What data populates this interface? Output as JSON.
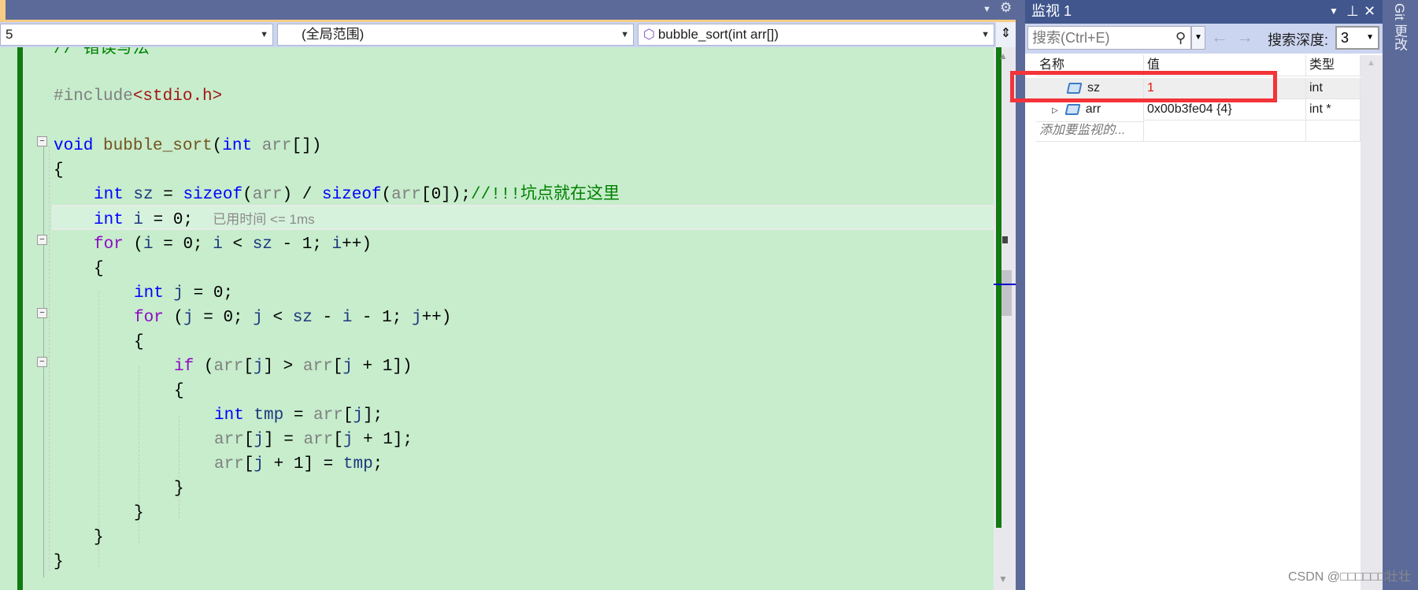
{
  "toolbar": {
    "gear_icon": "gear",
    "dropdown_icon": "triangle-down"
  },
  "nav": {
    "project": "5",
    "scope": "(全局范围)",
    "function": "bubble_sort(int arr[])"
  },
  "editor": {
    "comment": "// 错误写法",
    "include_directive": "#include",
    "include_file": "<stdio.h>",
    "code_lines": [
      "void bubble_sort(int arr[])",
      "{",
      "int sz = sizeof(arr) / sizeof(arr[0]);",
      "//!!!坑点就在这里",
      "int i = 0;",
      "for (i = 0; i < sz - 1; i++)",
      "{",
      "int j = 0;",
      "for (j = 0; j < sz - i - 1; j++)",
      "{",
      "if (arr[j] > arr[j + 1])",
      "{",
      "int tmp = arr[j];",
      "arr[j] = arr[j + 1];",
      "arr[j + 1] = tmp;",
      "}",
      "}",
      "}",
      "}"
    ],
    "perf_tip": "已用时间 <= 1ms"
  },
  "watch": {
    "title": "监视 1",
    "search_placeholder": "搜索(Ctrl+E)",
    "depth_label": "搜索深度:",
    "depth_value": "3",
    "columns": [
      "名称",
      "值",
      "类型"
    ],
    "rows": [
      {
        "name": "sz",
        "value": "1",
        "type": "int",
        "value_changed": true
      },
      {
        "name": "arr",
        "value": "0x00b3fe04 {4}",
        "type": "int *",
        "expandable": true
      }
    ],
    "add_placeholder": "添加要监视的..."
  },
  "side_tab": "Git 更改",
  "watermark": "CSDN @□□□□□□壮壮",
  "colors": {
    "changed_value": "#e51400",
    "highlight_box": "#f4333a",
    "editor_bg": "#c7edcc"
  }
}
